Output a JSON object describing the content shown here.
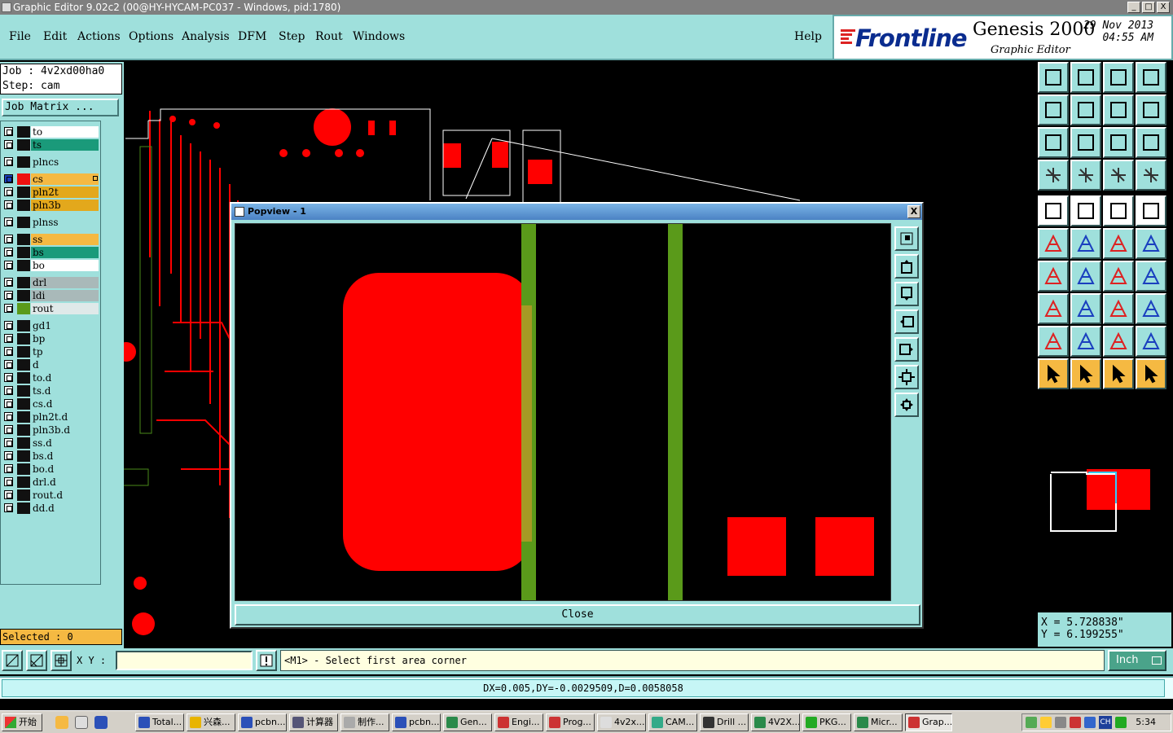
{
  "window": {
    "title": "Graphic Editor 9.02c2 (00@HY-HYCAM-PC037 - Windows, pid:1780)",
    "minimize": "_",
    "maximize": "□",
    "close": "X"
  },
  "menu": {
    "items": [
      "File",
      "Edit",
      "Actions",
      "Options",
      "Analysis",
      "DFM",
      "Step",
      "Rout",
      "Windows"
    ],
    "help": "Help"
  },
  "branding": {
    "logo": "Frontline",
    "product": "Genesis 2000",
    "subtitle": "Graphic Editor",
    "date": "29 Nov 2013",
    "time": "04:55 AM"
  },
  "job": {
    "job_line": "Job : 4v2xd00ha0",
    "step_line": "Step: cam",
    "matrix_button": "Job Matrix ..."
  },
  "layers": [
    {
      "name": "to",
      "color": "#ffffff",
      "swatch": "#111111"
    },
    {
      "name": "ts",
      "color": "#1a9a7a",
      "swatch": "#111111"
    },
    {
      "name": "plncs",
      "color": "#9fe0dc",
      "swatch": "#111111"
    },
    {
      "name": "cs",
      "color": "#f5b942",
      "swatch": "#ee1111",
      "active": true
    },
    {
      "name": "pln2t",
      "color": "#e3a81c",
      "swatch": "#111111"
    },
    {
      "name": "pln3b",
      "color": "#e3a81c",
      "swatch": "#111111"
    },
    {
      "name": "plnss",
      "color": "#9fe0dc",
      "swatch": "#111111"
    },
    {
      "name": "ss",
      "color": "#f5b942",
      "swatch": "#111111"
    },
    {
      "name": "bs",
      "color": "#1a9a7a",
      "swatch": "#111111"
    },
    {
      "name": "bo",
      "color": "#ffffff",
      "swatch": "#111111"
    },
    {
      "name": "drl",
      "color": "#a9b9b9",
      "swatch": "#111111"
    },
    {
      "name": "ldi",
      "color": "#a9b9b9",
      "swatch": "#111111"
    },
    {
      "name": "rout",
      "color": "#dfe9e9",
      "swatch": "#5a9a1a"
    },
    {
      "name": "gd1",
      "color": "#9fe0dc",
      "swatch": "#111111"
    },
    {
      "name": "bp",
      "color": "#9fe0dc",
      "swatch": "#111111"
    },
    {
      "name": "tp",
      "color": "#9fe0dc",
      "swatch": "#111111"
    },
    {
      "name": "d",
      "color": "#9fe0dc",
      "swatch": "#111111"
    },
    {
      "name": "to.d",
      "color": "#9fe0dc",
      "swatch": "#111111"
    },
    {
      "name": "ts.d",
      "color": "#9fe0dc",
      "swatch": "#111111"
    },
    {
      "name": "cs.d",
      "color": "#9fe0dc",
      "swatch": "#111111"
    },
    {
      "name": "pln2t.d",
      "color": "#9fe0dc",
      "swatch": "#111111"
    },
    {
      "name": "pln3b.d",
      "color": "#9fe0dc",
      "swatch": "#111111"
    },
    {
      "name": "ss.d",
      "color": "#9fe0dc",
      "swatch": "#111111"
    },
    {
      "name": "bs.d",
      "color": "#9fe0dc",
      "swatch": "#111111"
    },
    {
      "name": "bo.d",
      "color": "#9fe0dc",
      "swatch": "#111111"
    },
    {
      "name": "drl.d",
      "color": "#9fe0dc",
      "swatch": "#111111"
    },
    {
      "name": "rout.d",
      "color": "#9fe0dc",
      "swatch": "#111111"
    },
    {
      "name": "dd.d",
      "color": "#9fe0dc",
      "swatch": "#111111"
    }
  ],
  "selected": "Selected : 0",
  "coords": {
    "x": "X  =  5.728838\"",
    "y": "Y  =  6.199255\""
  },
  "popview": {
    "title": "Popview - 1",
    "close_x": "X",
    "close_button": "Close"
  },
  "input": {
    "xy_label": "X Y :",
    "xy_value": "",
    "prompt": "<M1> - Select first area corner",
    "unit": "Inch",
    "status": "DX=0.005,DY=-0.0029509,D=0.0058058"
  },
  "taskbar": {
    "start": "开始",
    "tasks": [
      "Total...",
      "兴森...",
      "pcbn...",
      "计算器",
      "制作...",
      "pcbn...",
      "Gen...",
      "Engi...",
      "Prog...",
      "4v2x...",
      "CAM...",
      "Drill ...",
      "4V2X...",
      "PKG...",
      "Micr...",
      "Grap..."
    ],
    "clock": "5:34",
    "tray_text": "CH"
  },
  "colors": {
    "copper": "#ff0000",
    "rout": "#5a9a1a",
    "panel": "#9fe0dc",
    "highlight": "#f5b942"
  }
}
